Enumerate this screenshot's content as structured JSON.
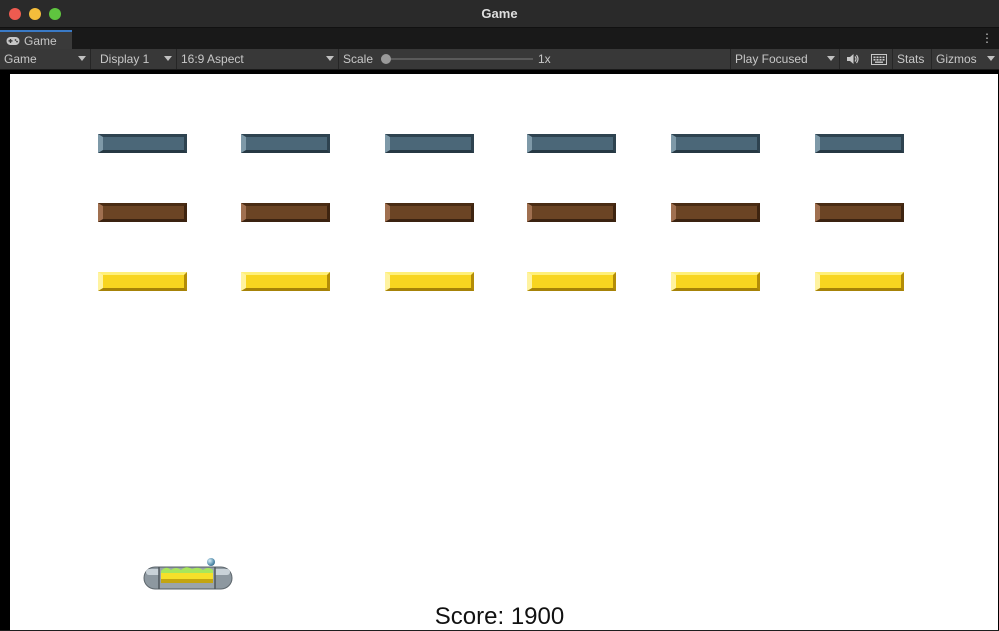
{
  "window": {
    "title": "Game"
  },
  "tabs": [
    {
      "label": "Game",
      "icon": "gamepad-icon"
    }
  ],
  "toolbar": {
    "view_select": "Game",
    "display_select": "Display 1",
    "aspect_select": "16:9 Aspect",
    "scale_label": "Scale",
    "scale_value": "1x",
    "scale_fraction": 0,
    "play_mode_select": "Play Focused",
    "audio_icon": "speaker-icon",
    "keyboard_icon": "keyboard-icon",
    "stats_label": "Stats",
    "gizmos_label": "Gizmos"
  },
  "game": {
    "score_text": "Score: 1900",
    "brick_rows": [
      {
        "color": "blue",
        "hex": "#4b6778",
        "count": 6
      },
      {
        "color": "brown",
        "hex": "#6b4424",
        "count": 6
      },
      {
        "color": "yellow",
        "hex": "#f8d520",
        "count": 6
      }
    ],
    "paddle": "paddle",
    "ball": "ball"
  },
  "colors": {
    "titlebar": "#2a2a2a",
    "toolbar": "#383838",
    "tab_accent": "#3a7ac6",
    "viewport_bg": "#ffffff"
  }
}
